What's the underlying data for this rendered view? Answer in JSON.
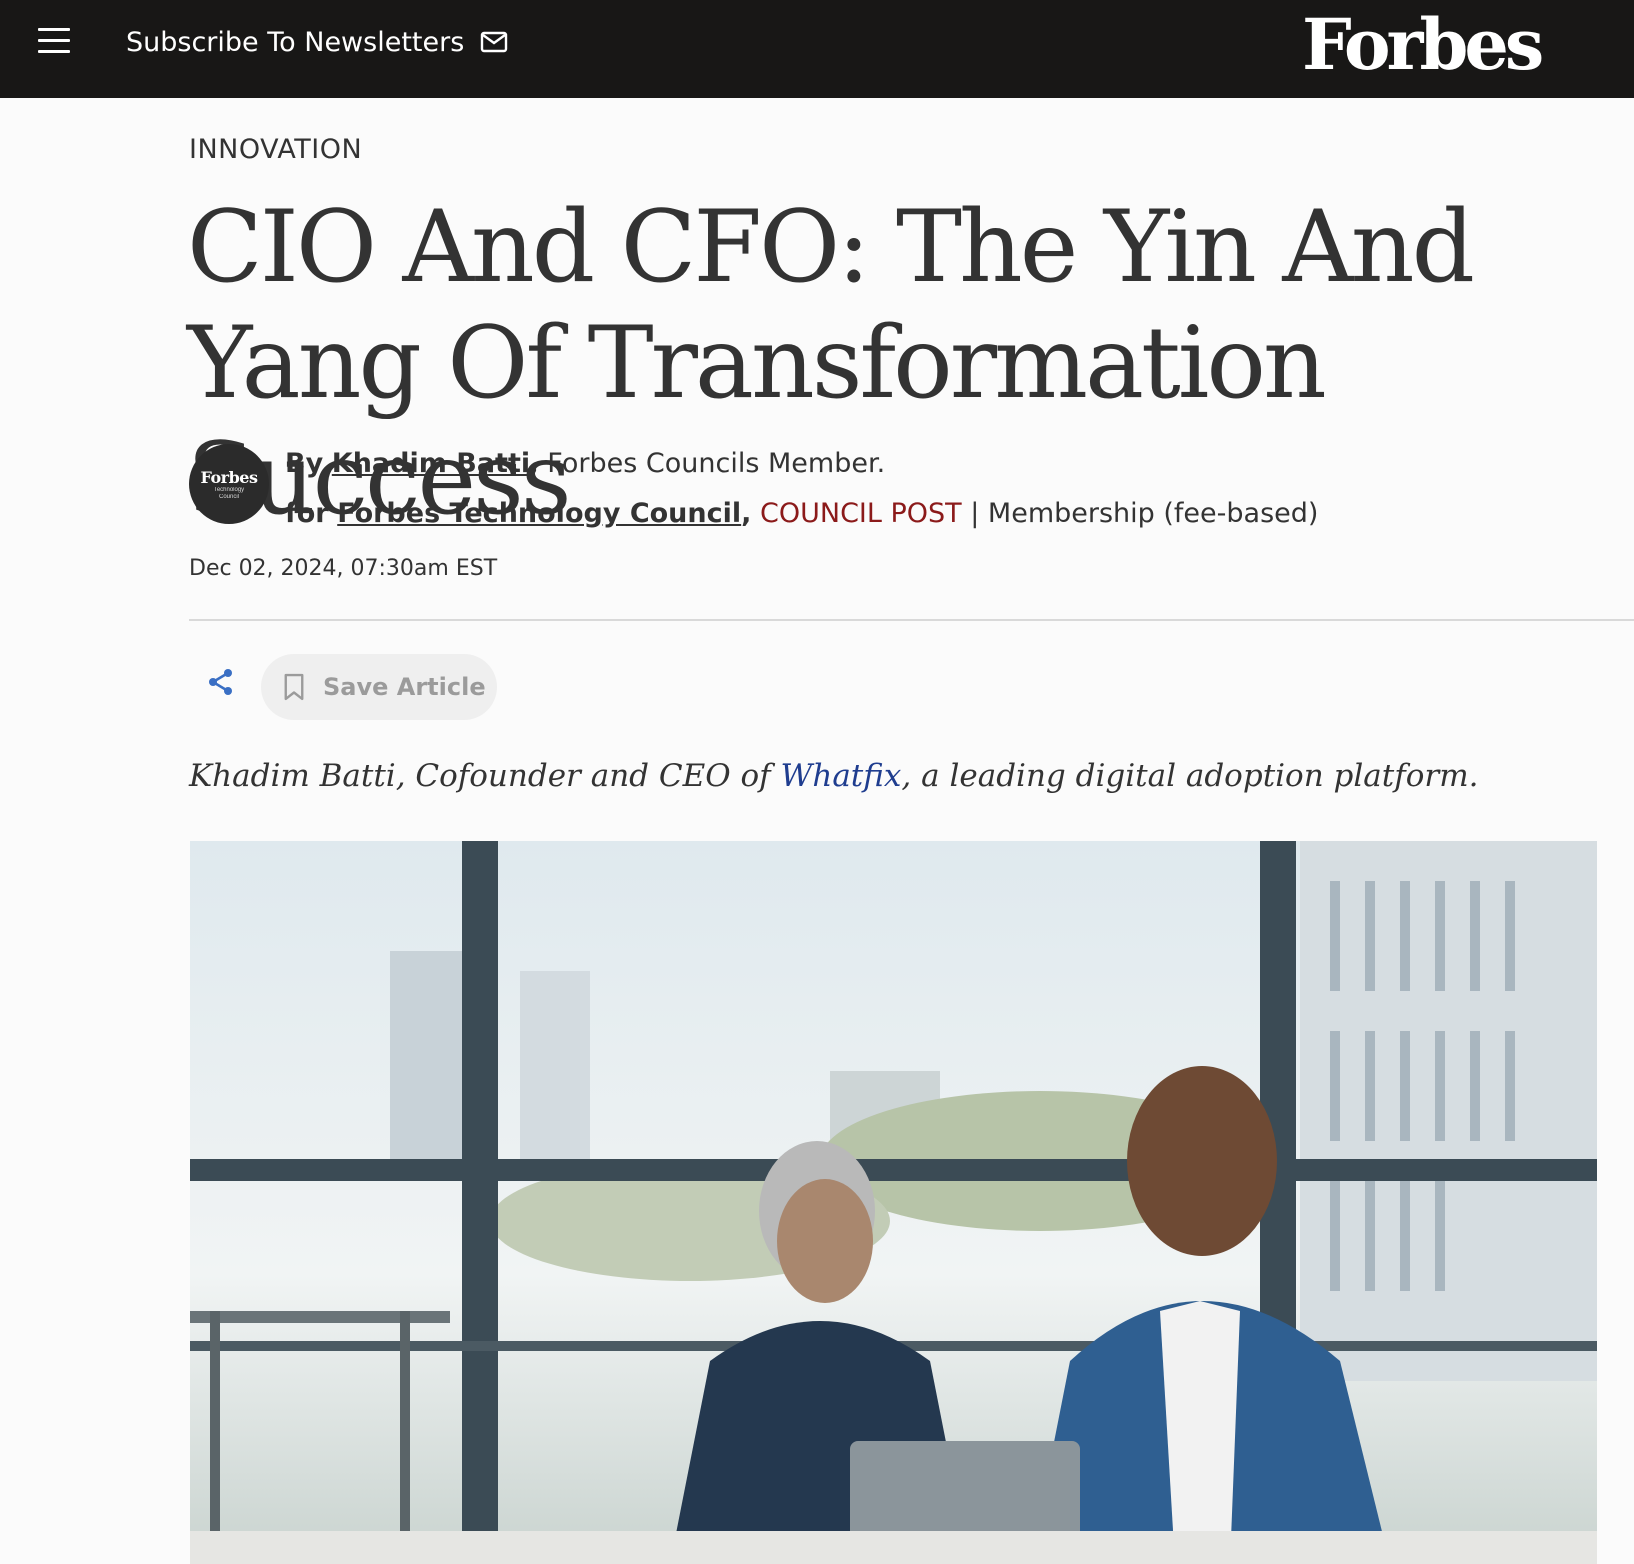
{
  "header": {
    "subscribe_label": "Subscribe To Newsletters",
    "logo_text": "Forbes",
    "background": "#181716"
  },
  "article": {
    "section": "INNOVATION",
    "headline": "CIO And CFO: The Yin And Yang Of Transformation Success",
    "avatar": {
      "name": "Forbes",
      "sub_line1": "Technology",
      "sub_line2": "Council"
    },
    "byline": {
      "by_label": "By",
      "author": "Khadim Batti",
      "author_role": ", Forbes Councils Member.",
      "for_label": "for",
      "council": "Forbes Technology Council",
      "comma": ",",
      "post_type": "COUNCIL POST",
      "membership": " | Membership (fee-based)"
    },
    "date": "Dec 02, 2024, 07:30am EST",
    "actions": {
      "save_label": "Save Article"
    },
    "subtitle": {
      "before": "Khadim Batti, Cofounder and CEO of ",
      "company": "Whatfix",
      "after": ", a leading digital adoption platform."
    }
  },
  "colors": {
    "accent_red": "#8b1a1a",
    "link_blue": "#1f3d8f",
    "share_blue": "#3a6fc4"
  }
}
